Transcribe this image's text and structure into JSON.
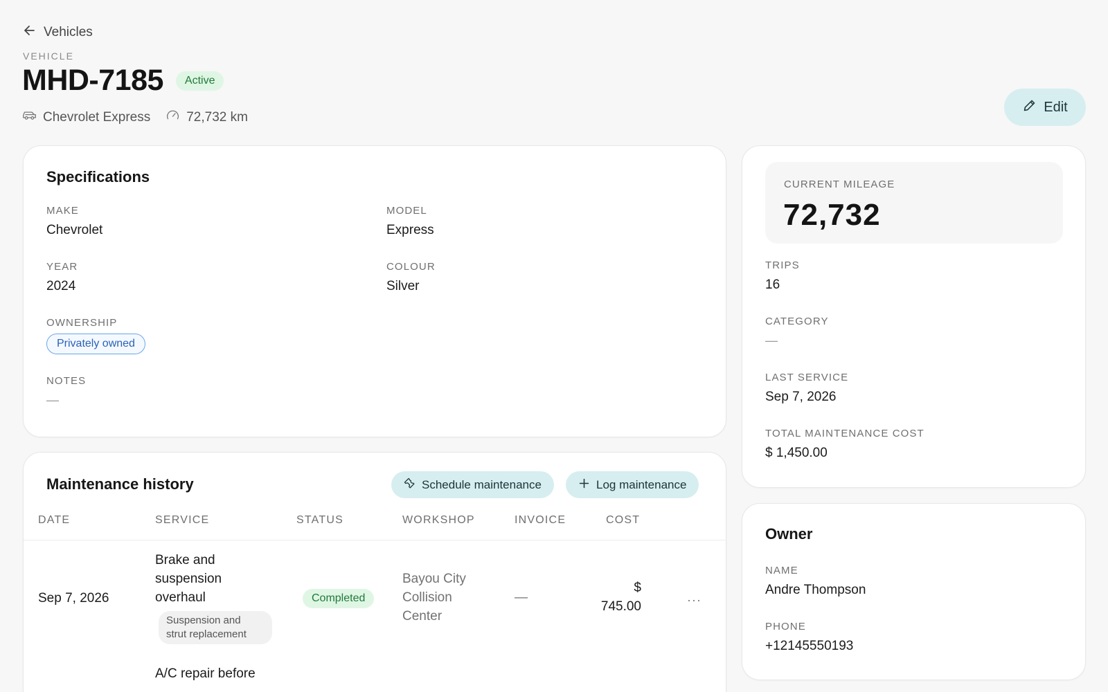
{
  "header": {
    "back_label": "Vehicles",
    "eyebrow": "VEHICLE",
    "plate": "MHD-7185",
    "status": "Active",
    "vehicle_name": "Chevrolet Express",
    "odometer": "72,732 km",
    "edit_label": "Edit"
  },
  "specifications": {
    "title": "Specifications",
    "make_label": "MAKE",
    "make": "Chevrolet",
    "model_label": "MODEL",
    "model": "Express",
    "year_label": "YEAR",
    "year": "2024",
    "colour_label": "COLOUR",
    "colour": "Silver",
    "ownership_label": "OWNERSHIP",
    "ownership": "Privately owned",
    "notes_label": "NOTES",
    "notes": "—"
  },
  "maintenance": {
    "title": "Maintenance history",
    "schedule_label": "Schedule maintenance",
    "log_label": "Log maintenance",
    "columns": [
      "DATE",
      "SERVICE",
      "STATUS",
      "WORKSHOP",
      "INVOICE",
      "COST"
    ],
    "rows": [
      {
        "date": "Sep 7, 2026",
        "service_line1": "Brake and",
        "service_line2": "suspension",
        "service_line3": "overhaul",
        "note_line1": "Suspension and",
        "note_line2": "strut replacement",
        "status": "Completed",
        "workshop_line1": "Bayou City",
        "workshop_line2": "Collision",
        "workshop_line3": "Center",
        "invoice": "—",
        "cost_line1": "$",
        "cost_line2": "745.00",
        "more": "···"
      },
      {
        "service_line1": "A/C repair before"
      }
    ]
  },
  "stats": {
    "mileage_label": "CURRENT MILEAGE",
    "mileage": "72,732",
    "trips_label": "TRIPS",
    "trips": "16",
    "category_label": "CATEGORY",
    "category": "—",
    "last_service_label": "LAST SERVICE",
    "last_service": "Sep 7, 2026",
    "total_cost_label": "TOTAL MAINTENANCE COST",
    "total_cost": "$ 1,450.00"
  },
  "owner": {
    "title": "Owner",
    "name_label": "NAME",
    "name": "Andre Thompson",
    "phone_label": "PHONE",
    "phone": "+12145550193"
  },
  "icons": {
    "back": "arrow-left-icon",
    "car": "car-icon",
    "speedometer": "speedometer-icon",
    "edit": "pencil-icon",
    "wrench": "wrench-icon",
    "plus": "plus-icon"
  },
  "colors": {
    "accent_button": "#d7eef0",
    "active_badge_bg": "#dff6e4",
    "active_badge_text": "#1f7a3a",
    "ownership_border": "#6aa6e8",
    "ownership_text": "#2a62b6",
    "background": "#f7f7f7"
  }
}
